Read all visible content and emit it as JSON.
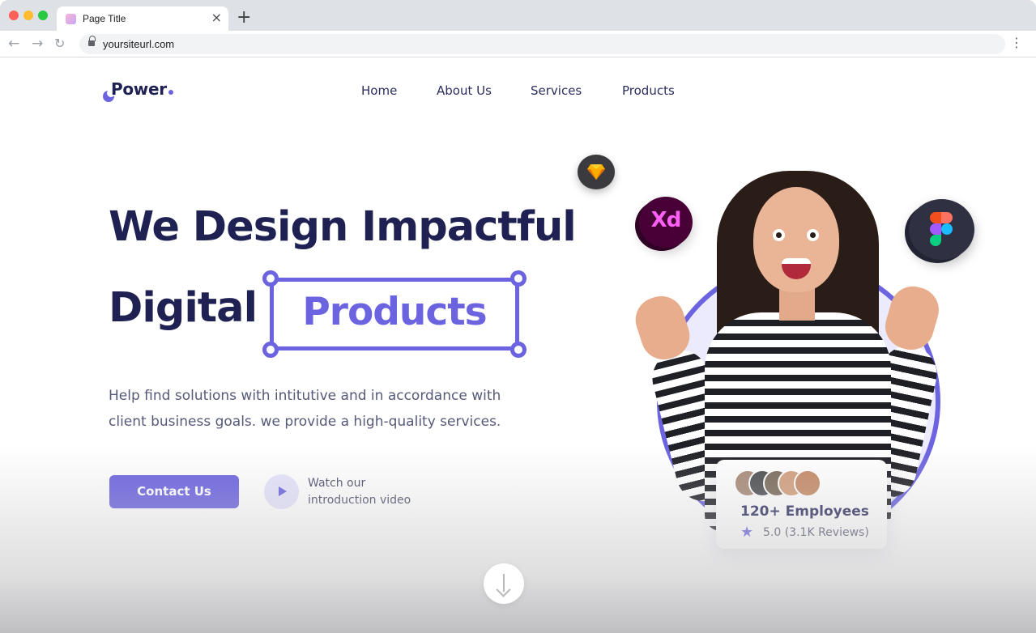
{
  "browser": {
    "tab_title": "Page Title",
    "tab_close_glyph": "×",
    "new_tab_glyph": "+",
    "back_glyph": "←",
    "forward_glyph": "→",
    "reload_glyph": "↻",
    "menu_glyph": "⋮",
    "url": "yoursiteurl.com"
  },
  "site": {
    "logo_text": "Power",
    "nav": [
      "Home",
      "About Us",
      "Services",
      "Products"
    ]
  },
  "hero": {
    "line1": "We Design Impactful",
    "line2": "Digital",
    "highlight": "Products",
    "subtext": "Help find solutions with intitutive and in accordance with client business goals. we provide a high-quality services.",
    "cta_label": "Contact Us",
    "video_label": "Watch our introduction video"
  },
  "badges": {
    "xd_label": "Xd"
  },
  "employees_card": {
    "title": "120+ Employees",
    "star_glyph": "★",
    "rating": "5.0 (3.1K Reviews)"
  },
  "colors": {
    "accent": "#6c63e0",
    "heading": "#1f2152",
    "body_text": "#555a78"
  },
  "icons": [
    "lock-icon",
    "sketch-icon",
    "adobe-xd-icon",
    "figma-icon",
    "play-icon",
    "star-icon",
    "scroll-down-arrow-icon"
  ]
}
